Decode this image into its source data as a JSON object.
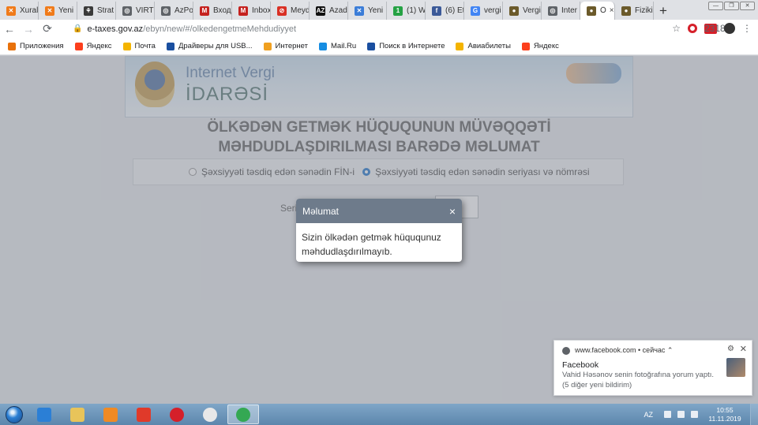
{
  "browser": {
    "tabs": [
      {
        "label": "Xural",
        "color": "#f07b1a",
        "glyph": "✕"
      },
      {
        "label": "Yeni",
        "color": "#f07b1a",
        "glyph": "✕"
      },
      {
        "label": "Strat",
        "color": "#3a3a3a",
        "glyph": "⚘"
      },
      {
        "label": "VİRT",
        "color": "#5f6368",
        "glyph": "◎"
      },
      {
        "label": "AzPo",
        "color": "#5f6368",
        "glyph": "◎"
      },
      {
        "label": "Входя",
        "color": "#c5221f",
        "glyph": "M"
      },
      {
        "label": "Inbox",
        "color": "#c5221f",
        "glyph": "M"
      },
      {
        "label": "Meyd",
        "color": "#d93025",
        "glyph": "⊘"
      },
      {
        "label": "Azadi",
        "color": "#111111",
        "glyph": "AZ"
      },
      {
        "label": "Yeni",
        "color": "#3b7dd8",
        "glyph": "✕"
      },
      {
        "label": "(1) W",
        "color": "#25a244",
        "glyph": "1"
      },
      {
        "label": "(6) Et",
        "color": "#3b5998",
        "glyph": "f"
      },
      {
        "label": "vergi",
        "color": "#4285f4",
        "glyph": "G"
      },
      {
        "label": "Vergi",
        "color": "#6b5a2a",
        "glyph": "●"
      },
      {
        "label": "İnter",
        "color": "#5f6368",
        "glyph": "◎"
      }
    ],
    "active_tab": {
      "label": "Ö",
      "color": "#6b5a2a",
      "glyph": "●",
      "close": "×"
    },
    "last_tab": {
      "label": "Fiziki",
      "color": "#6b5a2a",
      "glyph": "●"
    },
    "new_tab": "+",
    "win_buttons": [
      "—",
      "❐",
      "✕"
    ],
    "nav": {
      "back": "←",
      "forward": "→",
      "reload": "⟳"
    },
    "address": {
      "lock": "🔒",
      "domain": "e-taxes.gov.az",
      "path": "/ebyn/new/#/olkedengetmeMehdudiyyet"
    },
    "toolbar_icons": {
      "star": "☆",
      "menu": "⋮",
      "badge": "23185"
    }
  },
  "bookmarks": [
    {
      "label": "Приложения",
      "color": "#e8710a"
    },
    {
      "label": "Яндекс",
      "color": "#fc3f1d"
    },
    {
      "label": "Почта",
      "color": "#f4b400"
    },
    {
      "label": "Драйверы для USB...",
      "color": "#1a4fa0"
    },
    {
      "label": "Интернет",
      "color": "#f0a020"
    },
    {
      "label": "Mail.Ru",
      "color": "#168de2"
    },
    {
      "label": "Поиск в Интернете",
      "color": "#1a4fa0"
    },
    {
      "label": "Авиабилеты",
      "color": "#f4b400"
    },
    {
      "label": "Яндекс",
      "color": "#fc3f1d"
    }
  ],
  "page": {
    "brand_line1": "Internet Vergi",
    "brand_line2": "İDARƏSİ",
    "heading_line1": "ÖLKƏDƏN GETMƏK HÜQUQUNUN MÜVƏQQƏTİ",
    "heading_line2": "MƏHDUDLAŞDIRILMASI BARƏDƏ MƏLUMAT",
    "radio_fin": "Şəxsiyyəti təsdiq edən sənədin FİN-i",
    "radio_series": "Şəxsiyyəti təsdiq edən sənədin seriyası və nömrəsi",
    "series_label": "Seri"
  },
  "modal": {
    "title": "Məlumat",
    "close": "×",
    "message": "Sizin ölkədən getmək hüququnuz məhdudlaşdırılmayıb."
  },
  "notification": {
    "source": "www.facebook.com • сейчас ⌃",
    "gear": "⚙",
    "close": "✕",
    "title": "Facebook",
    "line1": "Vahid Həsənov senin fotoğrafına yorum yaptı.",
    "line2": "(5 diğer yeni bildirim)"
  },
  "taskbar": {
    "apps": [
      {
        "name": "ie",
        "color": "#2b7fd6"
      },
      {
        "name": "explorer",
        "color": "#e8c45a"
      },
      {
        "name": "media",
        "color": "#f08a24"
      },
      {
        "name": "yandex",
        "color": "#e03a2a"
      },
      {
        "name": "opera",
        "color": "#d5202a"
      },
      {
        "name": "yandex-browser",
        "color": "#e8e8e8"
      },
      {
        "name": "chrome",
        "color": "#34a853"
      }
    ],
    "lang": "AZ",
    "time": "10:55",
    "date": "11.11.2019"
  }
}
